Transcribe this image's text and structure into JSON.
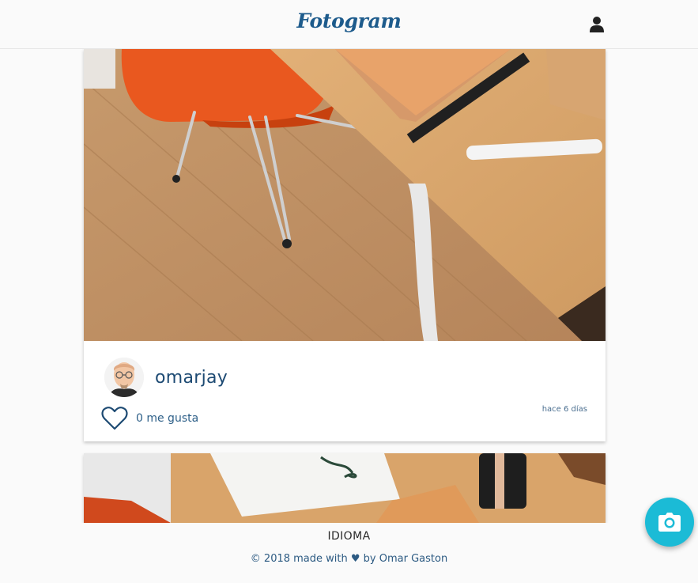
{
  "header": {
    "brand": "Fotogram",
    "user_icon": "user-icon"
  },
  "posts": [
    {
      "photo_alt": "Desk with orange chair, notebook and ruler",
      "author": "omarjay",
      "likes_label": "0 me gusta",
      "timestamp": "hace 6 días",
      "heart_icon": "heart-outline-icon"
    },
    {
      "photo_alt": "Desk with papers and leather items"
    }
  ],
  "footer": {
    "language": "IDIOMA",
    "credits": "© 2018 made with ♥ by Omar Gaston"
  },
  "fab": {
    "icon": "camera-icon"
  },
  "colors": {
    "brand": "#1d5b8c",
    "accent": "#1bbbd6",
    "text": "#1d4a73",
    "background": "#fafafa"
  }
}
